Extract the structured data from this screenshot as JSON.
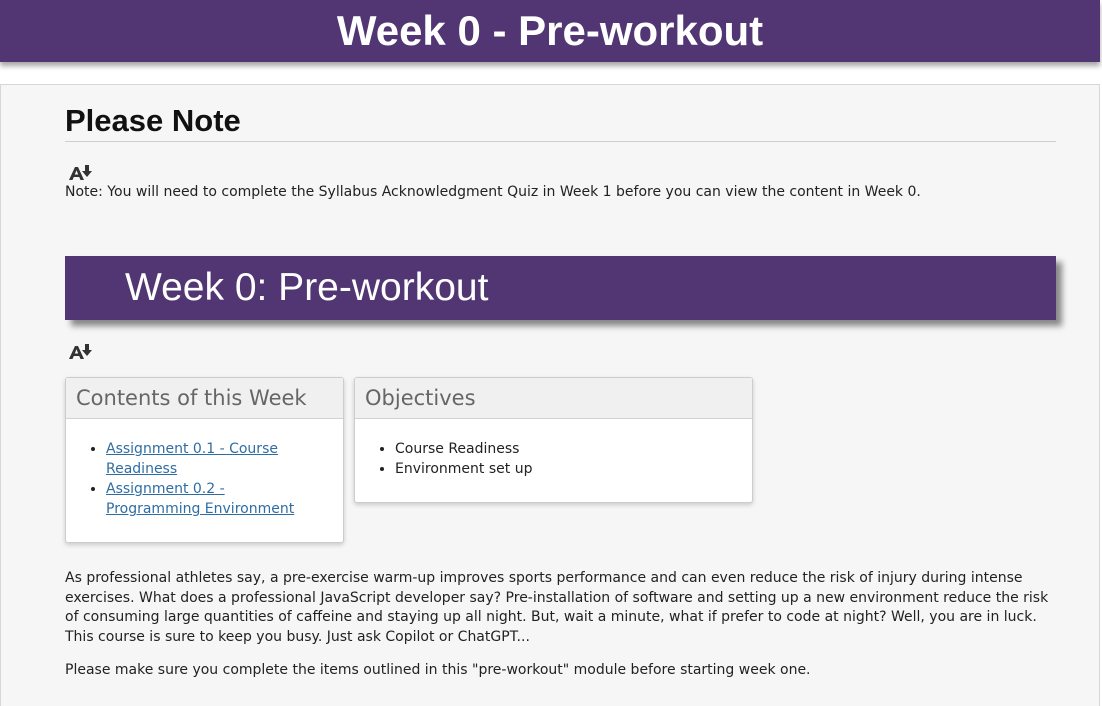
{
  "header": {
    "title": "Week 0 - Pre-workout"
  },
  "note": {
    "heading": "Please Note",
    "text": "Note:  You will need to complete the Syllabus Acknowledgment Quiz in Week 1 before you can view the content in Week 0."
  },
  "week": {
    "title": "Week 0: Pre-workout"
  },
  "contents": {
    "title": "Contents of this Week",
    "items": [
      {
        "label": "Assignment 0.1 - Course Readiness"
      },
      {
        "label": "Assignment 0.2 - Programming Environment"
      }
    ]
  },
  "objectives": {
    "title": "Objectives",
    "items": [
      "Course Readiness",
      "Environment set up"
    ]
  },
  "body": {
    "paragraph1": "As professional athletes say, a pre-exercise warm-up improves sports performance and can even reduce the risk of injury during intense exercises.  What does a professional JavaScript developer say?  Pre-installation of software and setting up a new environment reduce the risk of consuming large quantities of caffeine and staying up all night.  But, wait a minute, what if prefer to code at night?  Well, you are in luck.  This course is sure to keep you busy.  Just ask Copilot or ChatGPT...",
    "paragraph2": "Please make sure you complete the items outlined in this \"pre-workout\" module before starting week one."
  },
  "colors": {
    "brand": "#513673",
    "link": "#2e6da4"
  },
  "icons": {
    "readspeaker": "text-to-speech-download-icon"
  }
}
